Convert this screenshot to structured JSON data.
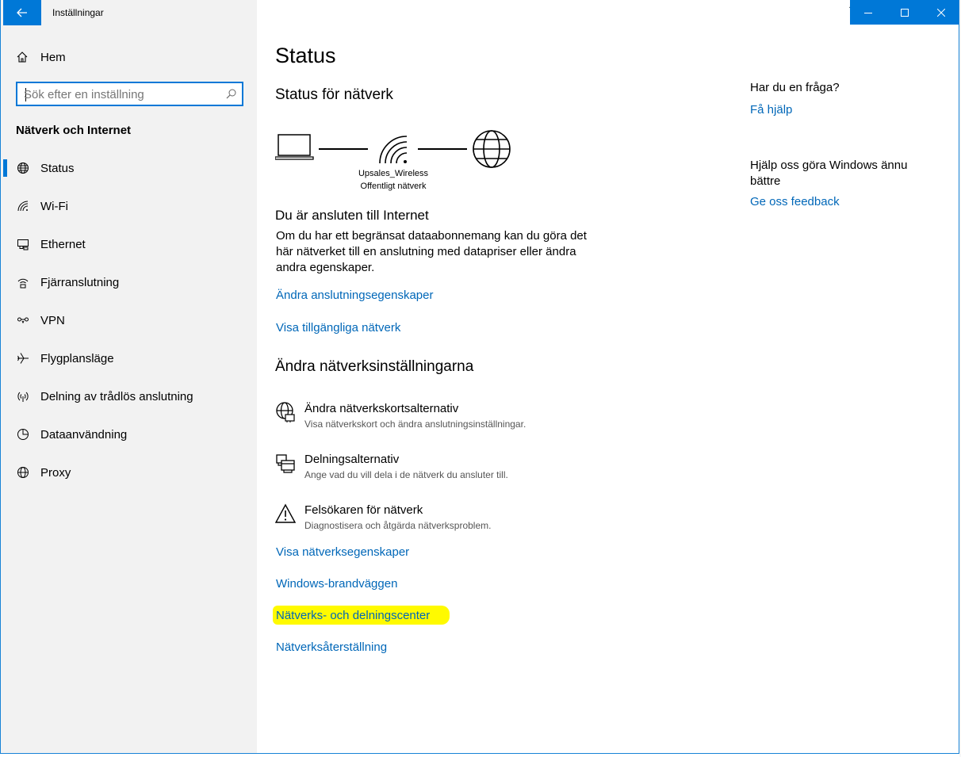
{
  "window": {
    "title": "Inställningar"
  },
  "sidebar": {
    "home_label": "Hem",
    "search_placeholder": "Sök efter en inställning",
    "section_title": "Nätverk och Internet",
    "items": [
      {
        "label": "Status",
        "icon": "globe-status-icon",
        "active": true
      },
      {
        "label": "Wi-Fi",
        "icon": "wifi-icon"
      },
      {
        "label": "Ethernet",
        "icon": "ethernet-icon"
      },
      {
        "label": "Fjärranslutning",
        "icon": "dialup-icon"
      },
      {
        "label": "VPN",
        "icon": "vpn-icon"
      },
      {
        "label": "Flygplansläge",
        "icon": "airplane-icon"
      },
      {
        "label": "Delning av trådlös anslutning",
        "icon": "hotspot-icon"
      },
      {
        "label": "Dataanvändning",
        "icon": "data-usage-icon"
      },
      {
        "label": "Proxy",
        "icon": "globe-icon"
      }
    ]
  },
  "main": {
    "title": "Status",
    "network_status_heading": "Status för nätverk",
    "network": {
      "name": "Upsales_Wireless",
      "type": "Offentligt nätverk"
    },
    "connected_heading": "Du är ansluten till Internet",
    "connected_text": "Om du har ett begränsat dataabonnemang kan du göra det här nätverket till en anslutning med datapriser eller ändra andra egenskaper.",
    "link_change_props": "Ändra anslutningsegenskaper",
    "link_show_networks": "Visa tillgängliga nätverk",
    "change_settings_heading": "Ändra nätverksinställningarna",
    "options": [
      {
        "title": "Ändra nätverkskortsalternativ",
        "desc": "Visa nätverkskort och ändra anslutningsinställningar.",
        "icon": "adapter-icon"
      },
      {
        "title": "Delningsalternativ",
        "desc": "Ange vad du vill dela i de nätverk du ansluter till.",
        "icon": "sharing-icon"
      },
      {
        "title": "Felsökaren för nätverk",
        "desc": "Diagnostisera och åtgärda nätverksproblem.",
        "icon": "warning-icon"
      }
    ],
    "link_network_props": "Visa nätverksegenskaper",
    "link_firewall": "Windows-brandväggen",
    "link_sharing_center": "Nätverks- och delningscenter",
    "link_reset": "Nätverksåterställning"
  },
  "right": {
    "question_heading": "Har du en fråga?",
    "help_link": "Få hjälp",
    "feedback_heading": "Hjälp oss göra Windows ännu bättre",
    "feedback_link": "Ge oss feedback"
  },
  "colors": {
    "accent": "#0078d7",
    "link": "#0067b8",
    "highlight": "#fffa00",
    "sidebar_bg": "#f2f2f2"
  }
}
